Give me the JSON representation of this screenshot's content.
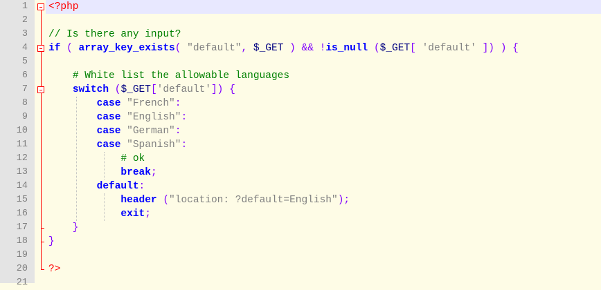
{
  "editor": {
    "line_numbers": [
      "1",
      "2",
      "3",
      "4",
      "5",
      "6",
      "7",
      "8",
      "9",
      "10",
      "11",
      "12",
      "13",
      "14",
      "15",
      "16",
      "17",
      "18",
      "19",
      "20",
      "21"
    ],
    "lines": [
      [
        {
          "t": "<?php",
          "c": "php-tag"
        }
      ],
      [],
      [
        {
          "t": "// Is there any input?",
          "c": "cm"
        }
      ],
      [
        {
          "t": "if",
          "c": "kw"
        },
        {
          "t": " ( ",
          "c": "op"
        },
        {
          "t": "array_key_exists",
          "c": "kw"
        },
        {
          "t": "( ",
          "c": "op"
        },
        {
          "t": "\"default\"",
          "c": "str"
        },
        {
          "t": ", ",
          "c": "op"
        },
        {
          "t": "$_GET",
          "c": "var"
        },
        {
          "t": " ) && !",
          "c": "op"
        },
        {
          "t": "is_null",
          "c": "kw"
        },
        {
          "t": " (",
          "c": "op"
        },
        {
          "t": "$_GET",
          "c": "var"
        },
        {
          "t": "[ ",
          "c": "op"
        },
        {
          "t": "'default'",
          "c": "str"
        },
        {
          "t": " ]) ) {",
          "c": "op"
        }
      ],
      [],
      [
        {
          "t": "    ",
          "c": "plain"
        },
        {
          "t": "# White list the allowable languages",
          "c": "cm"
        }
      ],
      [
        {
          "t": "    ",
          "c": "plain"
        },
        {
          "t": "switch",
          "c": "kw"
        },
        {
          "t": " (",
          "c": "op"
        },
        {
          "t": "$_GET",
          "c": "var"
        },
        {
          "t": "[",
          "c": "op"
        },
        {
          "t": "'default'",
          "c": "str"
        },
        {
          "t": "]) {",
          "c": "op"
        }
      ],
      [
        {
          "t": "        ",
          "c": "plain"
        },
        {
          "t": "case",
          "c": "kw"
        },
        {
          "t": " ",
          "c": "plain"
        },
        {
          "t": "\"French\"",
          "c": "str"
        },
        {
          "t": ":",
          "c": "op"
        }
      ],
      [
        {
          "t": "        ",
          "c": "plain"
        },
        {
          "t": "case",
          "c": "kw"
        },
        {
          "t": " ",
          "c": "plain"
        },
        {
          "t": "\"English\"",
          "c": "str"
        },
        {
          "t": ":",
          "c": "op"
        }
      ],
      [
        {
          "t": "        ",
          "c": "plain"
        },
        {
          "t": "case",
          "c": "kw"
        },
        {
          "t": " ",
          "c": "plain"
        },
        {
          "t": "\"German\"",
          "c": "str"
        },
        {
          "t": ":",
          "c": "op"
        }
      ],
      [
        {
          "t": "        ",
          "c": "plain"
        },
        {
          "t": "case",
          "c": "kw"
        },
        {
          "t": " ",
          "c": "plain"
        },
        {
          "t": "\"Spanish\"",
          "c": "str"
        },
        {
          "t": ":",
          "c": "op"
        }
      ],
      [
        {
          "t": "            ",
          "c": "plain"
        },
        {
          "t": "# ok",
          "c": "cm"
        }
      ],
      [
        {
          "t": "            ",
          "c": "plain"
        },
        {
          "t": "break",
          "c": "kw"
        },
        {
          "t": ";",
          "c": "op"
        }
      ],
      [
        {
          "t": "        ",
          "c": "plain"
        },
        {
          "t": "default",
          "c": "kw"
        },
        {
          "t": ":",
          "c": "op"
        }
      ],
      [
        {
          "t": "            ",
          "c": "plain"
        },
        {
          "t": "header",
          "c": "kw"
        },
        {
          "t": " (",
          "c": "op"
        },
        {
          "t": "\"location: ?default=English\"",
          "c": "str"
        },
        {
          "t": ");",
          "c": "op"
        }
      ],
      [
        {
          "t": "            ",
          "c": "plain"
        },
        {
          "t": "exit",
          "c": "kw"
        },
        {
          "t": ";",
          "c": "op"
        }
      ],
      [
        {
          "t": "    }",
          "c": "op"
        }
      ],
      [
        {
          "t": "}",
          "c": "op"
        }
      ],
      [],
      [
        {
          "t": "?>",
          "c": "php-tag"
        }
      ],
      []
    ]
  },
  "colors": {
    "background": "#fefce6",
    "gutter": "#e4e4e4",
    "current_line": "#e8e8ff",
    "keyword": "#0000ff",
    "php_tag": "#ff0000",
    "string": "#808080",
    "operator": "#8000ff",
    "comment": "#008000"
  }
}
